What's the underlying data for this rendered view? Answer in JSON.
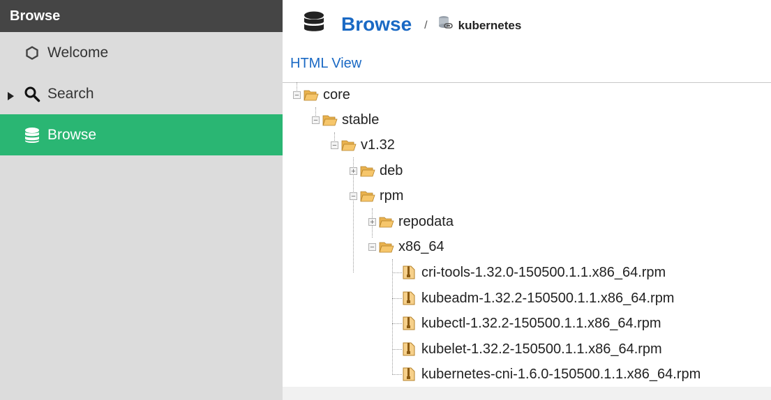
{
  "sidebar": {
    "header": "Browse",
    "items": [
      {
        "label": "Welcome",
        "icon": "hexagon-icon"
      },
      {
        "label": "Search",
        "icon": "magnifier-icon"
      },
      {
        "label": "Browse",
        "icon": "database-icon",
        "active": true
      }
    ]
  },
  "breadcrumb": {
    "title": "Browse",
    "separator": "/",
    "repository": "kubernetes"
  },
  "html_view_link": "HTML View",
  "tree": {
    "core": "core",
    "stable": "stable",
    "version": "v1.32",
    "deb": "deb",
    "rpm": "rpm",
    "repodata": "repodata",
    "arch": "x86_64",
    "files": [
      "cri-tools-1.32.0-150500.1.1.x86_64.rpm",
      "kubeadm-1.32.2-150500.1.1.x86_64.rpm",
      "kubectl-1.32.2-150500.1.1.x86_64.rpm",
      "kubelet-1.32.2-150500.1.1.x86_64.rpm",
      "kubernetes-cni-1.6.0-150500.1.1.x86_64.rpm"
    ]
  },
  "colors": {
    "sidebar_header": "#454545",
    "sidebar_bg": "#dcdcdc",
    "active_item": "#2ab673",
    "link_blue": "#1a69c4",
    "folder_yellow": "#f6c66b"
  }
}
